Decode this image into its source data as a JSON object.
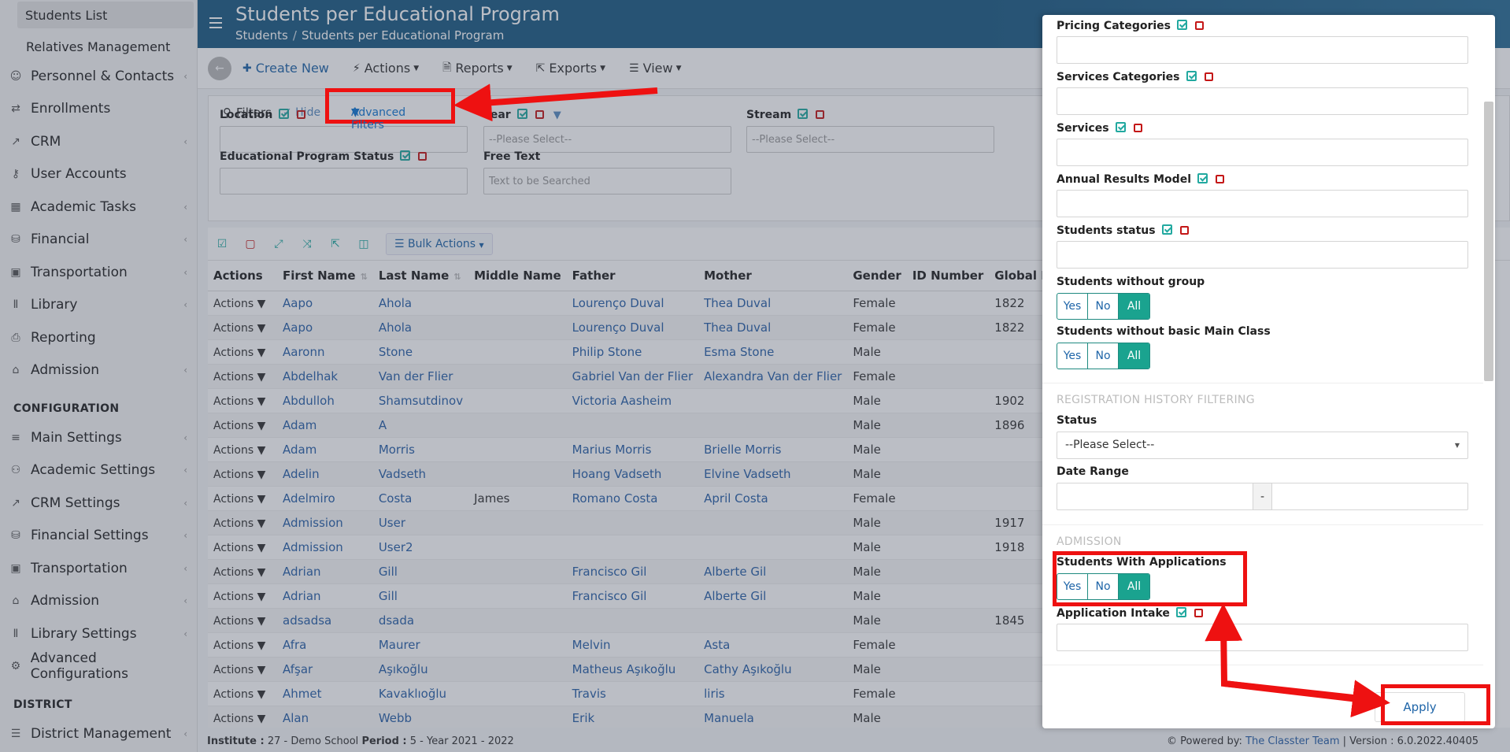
{
  "sidebar": {
    "sub_items": [
      "Students List",
      "Relatives Management"
    ],
    "items": [
      {
        "label": "Personnel & Contacts",
        "icon": "contacts-icon",
        "chevron": true
      },
      {
        "label": "Enrollments",
        "icon": "swap-arrows-icon",
        "chevron": false
      },
      {
        "label": "CRM",
        "icon": "crm-icon",
        "chevron": true
      },
      {
        "label": "User Accounts",
        "icon": "key-icon",
        "chevron": false
      },
      {
        "label": "Academic Tasks",
        "icon": "grid-icon",
        "chevron": true
      },
      {
        "label": "Financial",
        "icon": "coins-icon",
        "chevron": true
      },
      {
        "label": "Transportation",
        "icon": "bus-icon",
        "chevron": true
      },
      {
        "label": "Library",
        "icon": "books-icon",
        "chevron": true
      },
      {
        "label": "Reporting",
        "icon": "print-icon",
        "chevron": false
      },
      {
        "label": "Admission",
        "icon": "institution-icon",
        "chevron": true
      }
    ],
    "config_heading": "CONFIGURATION",
    "config_items": [
      {
        "label": "Main Settings",
        "icon": "sliders-icon",
        "chevron": true
      },
      {
        "label": "Academic Settings",
        "icon": "users-icon",
        "chevron": true
      },
      {
        "label": "CRM Settings",
        "icon": "crm-icon",
        "chevron": true
      },
      {
        "label": "Financial Settings",
        "icon": "coins-icon",
        "chevron": true
      },
      {
        "label": "Transportation",
        "icon": "bus-icon",
        "chevron": true
      },
      {
        "label": "Admission",
        "icon": "institution-icon",
        "chevron": true
      },
      {
        "label": "Library Settings",
        "icon": "books-icon",
        "chevron": true
      },
      {
        "label": "Advanced Configurations",
        "icon": "gears-icon",
        "chevron": false
      }
    ],
    "district_heading": "DISTRICT",
    "district_items": [
      {
        "label": "District Management",
        "icon": "list-icon",
        "chevron": true
      }
    ]
  },
  "header": {
    "title": "Students per Educational Program",
    "breadcrumb": [
      "Students",
      "Students per Educational Program"
    ]
  },
  "toolbar": {
    "create": "Create New",
    "actions": "Actions",
    "reports": "Reports",
    "exports": "Exports",
    "view": "View"
  },
  "filters": {
    "title": "Filters",
    "hide": "Hide",
    "advanced": "Advanced Filters",
    "location": "Location",
    "year": "Year",
    "year_placeholder": "--Please Select--",
    "stream": "Stream",
    "stream_placeholder": "--Please Select--",
    "program_status": "Educational Program Status",
    "free_text": "Free Text",
    "free_text_placeholder": "Text to be Searched"
  },
  "table_toolbar": {
    "bulk_actions": "Bulk Actions"
  },
  "table": {
    "columns": [
      "Actions",
      "First Name",
      "Last Name",
      "Middle Name",
      "Father",
      "Mother",
      "Gender",
      "ID Number",
      "Global Registratio"
    ],
    "action_label": "Actions",
    "rows": [
      [
        "Aapo",
        "Ahola",
        "",
        "Lourenço Duval",
        "Thea Duval",
        "Female",
        "",
        "1822"
      ],
      [
        "Aapo",
        "Ahola",
        "",
        "Lourenço Duval",
        "Thea Duval",
        "Female",
        "",
        "1822"
      ],
      [
        "Aaronn",
        "Stone",
        "",
        "Philip Stone",
        "Esma Stone",
        "Male",
        "",
        ""
      ],
      [
        "Abdelhak",
        "Van der Flier",
        "",
        "Gabriel Van der Flier",
        "Alexandra Van der Flier",
        "Female",
        "",
        ""
      ],
      [
        "Abdulloh",
        "Shamsutdinov",
        "",
        "Victoria Aasheim",
        "",
        "Male",
        "",
        "1902"
      ],
      [
        "Adam",
        "A",
        "",
        "",
        "",
        "Male",
        "",
        "1896"
      ],
      [
        "Adam",
        "Morris",
        "",
        "Marius Morris",
        "Brielle Morris",
        "Male",
        "",
        ""
      ],
      [
        "Adelin",
        "Vadseth",
        "",
        "Hoang Vadseth",
        "Elvine Vadseth",
        "Male",
        "",
        ""
      ],
      [
        "Adelmiro",
        "Costa",
        "James",
        "Romano Costa",
        "April Costa",
        "Female",
        "",
        ""
      ],
      [
        "Admission",
        "User",
        "",
        "",
        "",
        "Male",
        "",
        "1917"
      ],
      [
        "Admission",
        "User2",
        "",
        "",
        "",
        "Male",
        "",
        "1918"
      ],
      [
        "Adrian",
        "Gill",
        "",
        "Francisco Gil",
        "Alberte Gil",
        "Male",
        "",
        ""
      ],
      [
        "Adrian",
        "Gill",
        "",
        "Francisco Gil",
        "Alberte Gil",
        "Male",
        "",
        ""
      ],
      [
        "adsadsa",
        "dsada",
        "",
        "",
        "",
        "Male",
        "",
        "1845"
      ],
      [
        "Afra",
        "Maurer",
        "",
        "Melvin",
        "Asta",
        "Female",
        "",
        ""
      ],
      [
        "Afşar",
        "Aşıkoğlu",
        "",
        "Matheus Aşıkoğlu",
        "Cathy Aşıkoğlu",
        "Male",
        "",
        ""
      ],
      [
        "Ahmet",
        "Kavaklıoğlu",
        "",
        "Travis",
        "liris",
        "Female",
        "",
        ""
      ],
      [
        "Alan",
        "Webb",
        "",
        "Erik",
        "Manuela",
        "Male",
        "",
        ""
      ]
    ]
  },
  "footer": {
    "institute_label": "Institute :",
    "institute_value": "27 - Demo School",
    "period_label": "Period :",
    "period_value": "5 - Year 2021 - 2022",
    "powered_by": "Powered by:",
    "team": "The Classter Team",
    "version": "| Version : 6.0.2022.40405"
  },
  "panel": {
    "pricing_categories": "Pricing Categories",
    "services_categories": "Services Categories",
    "services": "Services",
    "annual_results_model": "Annual Results Model",
    "students_status": "Students status",
    "students_without_group": "Students without group",
    "students_without_main_class": "Students without basic Main Class",
    "seg_yes": "Yes",
    "seg_no": "No",
    "seg_all": "All",
    "registration_history": "REGISTRATION HISTORY FILTERING",
    "status": "Status",
    "status_placeholder": "--Please Select--",
    "date_range": "Date Range",
    "date_dash": "-",
    "admission_section": "ADMISSION",
    "students_with_applications": "Students With Applications",
    "application_intake": "Application Intake",
    "apply": "Apply"
  },
  "colors": {
    "header_blue": "#1d5b83",
    "link_blue": "#2a61a8",
    "teal": "#1aa38f",
    "annotation_red": "#ee1111"
  }
}
